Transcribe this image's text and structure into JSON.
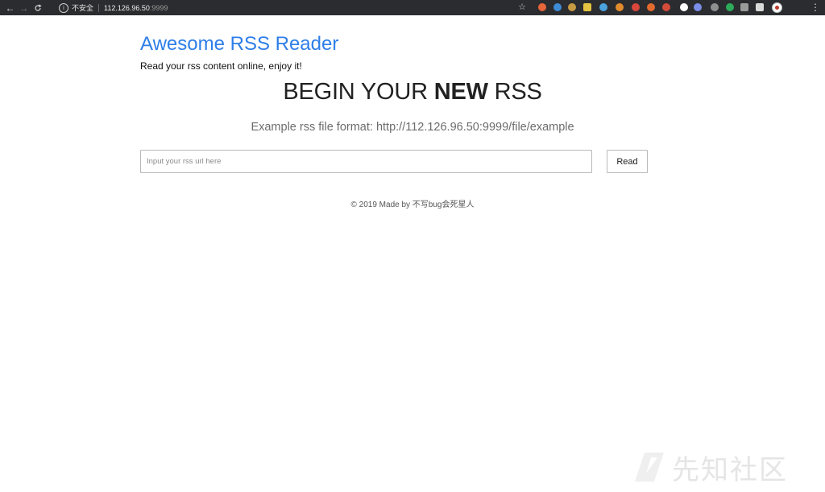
{
  "browser": {
    "back_icon": "←",
    "forward_icon": "→",
    "reload_icon": "C",
    "info_icon": "i",
    "security_label": "不安全",
    "url_host": "112.126.96.50",
    "url_port": ":9999",
    "star_icon": "☆",
    "menu_icon": "⋮",
    "extensions": [
      {
        "name": "ext-1-icon",
        "color": "#e8653b"
      },
      {
        "name": "ext-2-icon",
        "color": "#3e8bd6"
      },
      {
        "name": "ext-3-icon",
        "color": "#c89a43"
      },
      {
        "name": "ext-4-icon",
        "color": "#e3c341"
      },
      {
        "name": "ext-5-icon",
        "color": "#4aa3df"
      },
      {
        "name": "ext-6-icon",
        "color": "#e28b2d"
      },
      {
        "name": "ext-7-icon",
        "color": "#d9463b"
      },
      {
        "name": "ext-8-icon",
        "color": "#e36a2e"
      },
      {
        "name": "ext-9-icon",
        "color": "#d34b3a"
      },
      {
        "name": "ext-10-icon",
        "color": "#ffffff"
      },
      {
        "name": "ext-11-icon",
        "color": "#7b8ee8"
      },
      {
        "name": "ext-12-icon",
        "color": "#8f8f8f"
      },
      {
        "name": "ext-13-icon",
        "color": "#2cab5a"
      },
      {
        "name": "ext-14-icon",
        "color": "#9a9a9a"
      },
      {
        "name": "ext-15-icon",
        "color": "#d9d9d9"
      }
    ]
  },
  "page": {
    "site_title": "Awesome RSS Reader",
    "site_subtitle": "Read your rss content online, enjoy it!",
    "hero_prefix": "BEGIN YOUR ",
    "hero_bold": "NEW",
    "hero_suffix": " RSS",
    "example_text": "Example rss file format: http://112.126.96.50:9999/file/example",
    "input_placeholder": "Input your rss url here",
    "input_value": "",
    "read_button": "Read",
    "footer": "© 2019 Made by 不写bug会死星人"
  },
  "watermark": {
    "text": "先知社区"
  },
  "colors": {
    "accent": "#2d7ee8",
    "toolbar": "#2b2c2f"
  }
}
